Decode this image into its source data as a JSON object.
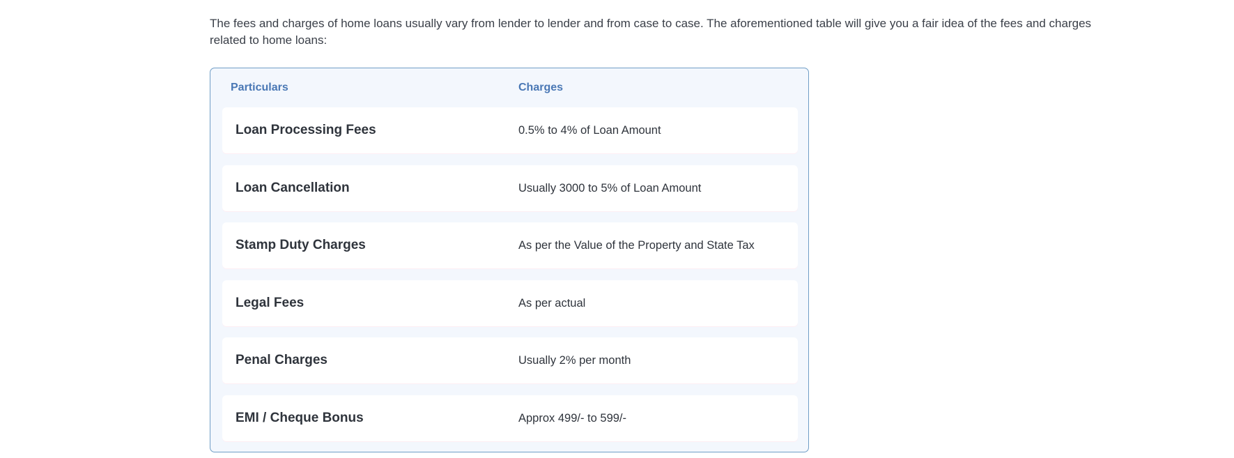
{
  "intro_text": "The fees and charges of home loans usually vary from lender to lender and from case to case. The aforementioned table will give you a fair idea of the fees and charges related to home loans:",
  "table": {
    "headers": {
      "particulars": "Particulars",
      "charges": "Charges"
    },
    "rows": [
      {
        "particular": "Loan Processing Fees",
        "charge": "0.5% to 4% of Loan Amount"
      },
      {
        "particular": "Loan Cancellation",
        "charge": "Usually 3000 to 5% of Loan Amount"
      },
      {
        "particular": "Stamp Duty Charges",
        "charge": "As per the Value of the Property and State Tax"
      },
      {
        "particular": "Legal Fees",
        "charge": "As per actual"
      },
      {
        "particular": "Penal Charges",
        "charge": "Usually 2% per month"
      },
      {
        "particular": "EMI / Cheque Bonus",
        "charge": "Approx 499/- to 599/-"
      }
    ]
  },
  "colors": {
    "header_text": "#4a78b5",
    "table_border": "#6f9dc6",
    "table_background": "#f3f7fd",
    "row_background": "#ffffff"
  }
}
